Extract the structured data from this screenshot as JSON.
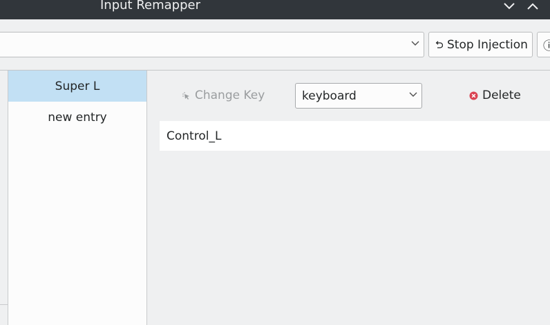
{
  "window": {
    "title": "Input Remapper"
  },
  "toolbar": {
    "preset_value": "",
    "stop_injection_label": "Stop Injection",
    "info_label": "ⓘ"
  },
  "key_list": {
    "items": [
      {
        "label": "Super L",
        "selected": true
      },
      {
        "label": "new entry",
        "selected": false
      }
    ]
  },
  "editor": {
    "change_key_label": "Change Key",
    "type_value": "keyboard",
    "delete_label": "Delete",
    "symbol_value": "Control_L"
  },
  "colors": {
    "titlebar": "#31363b",
    "selection": "#c2e0f4",
    "delete_icon": "#da4453",
    "disabled_text": "#9a9d9f"
  },
  "icons": {
    "minimize": "chevron-down-icon",
    "maximize": "chevron-up-icon",
    "stop": "undo-arrow-icon",
    "change_key": "key-press-icon",
    "delete": "delete-circle-icon"
  }
}
